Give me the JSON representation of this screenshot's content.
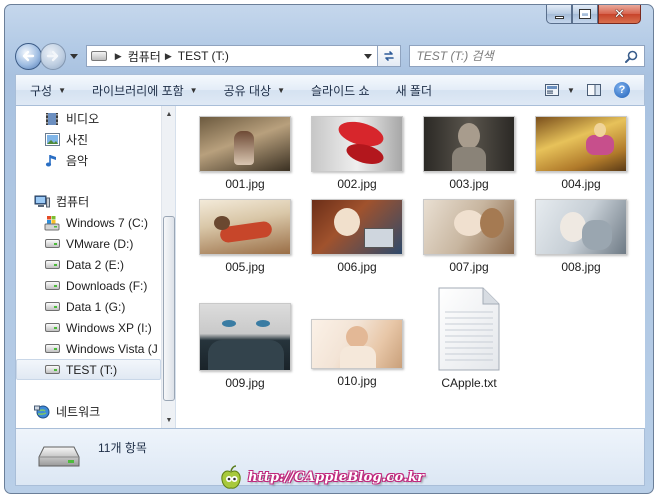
{
  "window": {
    "caption": {
      "minimize": "minimize",
      "maximize": "maximize",
      "close": "close"
    }
  },
  "navigation": {
    "breadcrumb": [
      "컴퓨터",
      "TEST (T:)"
    ],
    "search_placeholder": "TEST (T:) 검색"
  },
  "toolbar": {
    "organize": "구성",
    "include_in_library": "라이브러리에 포함",
    "share_with": "공유 대상",
    "slideshow": "슬라이드 쇼",
    "new_folder": "새 폴더"
  },
  "nav_pane": {
    "libraries": [
      {
        "label": "비디오",
        "icon": "video-library-icon"
      },
      {
        "label": "사진",
        "icon": "pictures-library-icon"
      },
      {
        "label": "음악",
        "icon": "music-library-icon"
      }
    ],
    "computer": {
      "label": "컴퓨터",
      "icon": "computer-icon"
    },
    "drives": [
      {
        "label": "Windows 7 (C:)",
        "icon": "windows-drive-icon"
      },
      {
        "label": "VMware (D:)",
        "icon": "drive-icon"
      },
      {
        "label": "Data 2 (E:)",
        "icon": "drive-icon"
      },
      {
        "label": "Downloads (F:)",
        "icon": "drive-icon"
      },
      {
        "label": "Data 1 (G:)",
        "icon": "drive-icon"
      },
      {
        "label": "Windows XP (I:)",
        "icon": "drive-icon"
      },
      {
        "label": "Windows Vista (J",
        "icon": "drive-icon"
      },
      {
        "label": "TEST (T:)",
        "icon": "drive-icon",
        "selected": true
      }
    ],
    "network": {
      "label": "네트워크",
      "icon": "network-icon"
    }
  },
  "files": [
    {
      "name": "001.jpg",
      "type": "image",
      "colors": [
        "#6c5a3f",
        "#b8a07d",
        "#2f2a1f"
      ]
    },
    {
      "name": "002.jpg",
      "type": "image",
      "colors": [
        "#d9d9d9",
        "#d7262c",
        "#9a9a9a"
      ]
    },
    {
      "name": "003.jpg",
      "type": "image",
      "colors": [
        "#4a4640",
        "#8a8378",
        "#2b2925"
      ]
    },
    {
      "name": "004.jpg",
      "type": "image",
      "colors": [
        "#b07a2a",
        "#e7c25a",
        "#c74f8c"
      ]
    },
    {
      "name": "005.jpg",
      "type": "image",
      "colors": [
        "#d9c7a8",
        "#9a6e46",
        "#c7462a"
      ]
    },
    {
      "name": "006.jpg",
      "type": "image",
      "colors": [
        "#a0522d",
        "#f1e8dc",
        "#2e4a6b"
      ]
    },
    {
      "name": "007.jpg",
      "type": "image",
      "colors": [
        "#c8b6a0",
        "#8c6a4c",
        "#e9dfd2"
      ]
    },
    {
      "name": "008.jpg",
      "type": "image",
      "colors": [
        "#c7cfd6",
        "#9aa6b0",
        "#6e7a85"
      ]
    },
    {
      "name": "009.jpg",
      "type": "image",
      "colors": [
        "#dcdcdc",
        "#3a5f74",
        "#26343c"
      ]
    },
    {
      "name": "010.jpg",
      "type": "image",
      "colors": [
        "#f3e4d6",
        "#e8c7a8",
        "#c9a07a"
      ]
    },
    {
      "name": "CApple.txt",
      "type": "text"
    }
  ],
  "details": {
    "item_count": "11개 항목"
  },
  "watermark": {
    "text": "http://CAppleBlog.co.kr"
  }
}
